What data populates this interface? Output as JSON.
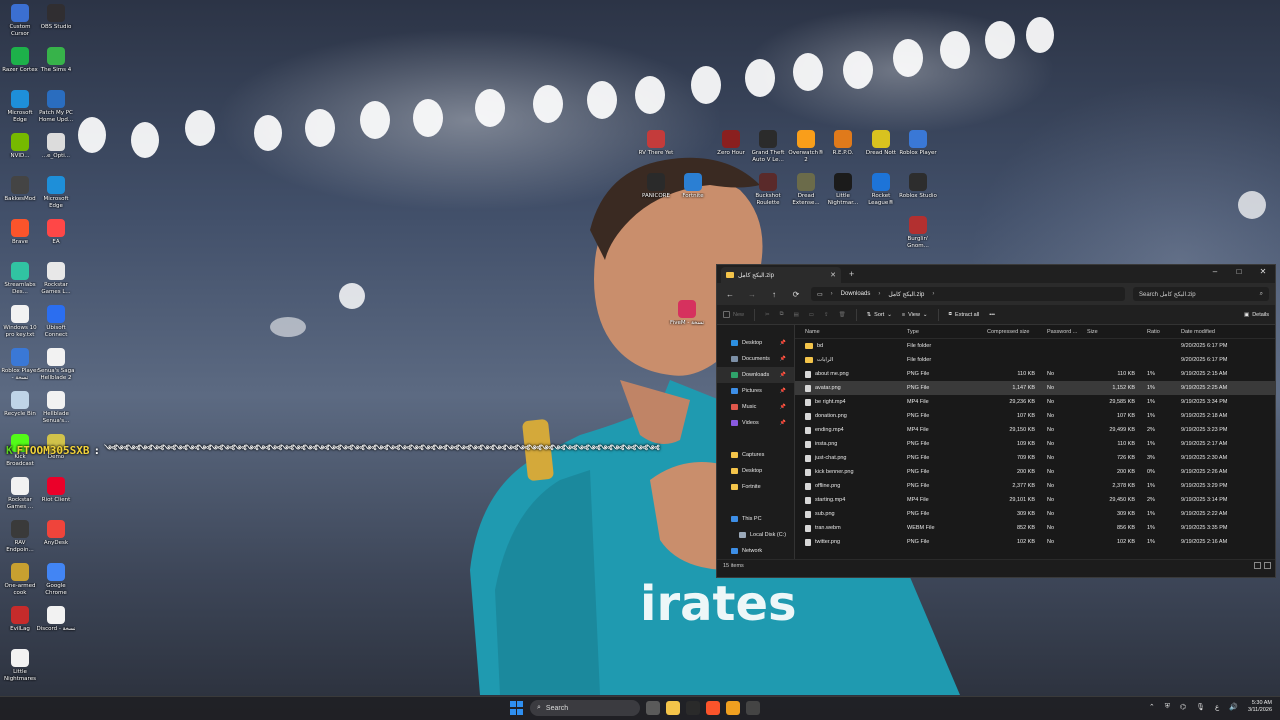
{
  "desktop_icons_left": [
    {
      "label": "Custom Cursor",
      "icon": "cursor-icon",
      "color": "#3b6fd1"
    },
    {
      "label": "OBS Studio",
      "icon": "obs-icon",
      "color": "#302e31"
    },
    {
      "label": "Razer Cortex",
      "icon": "razer-icon",
      "color": "#1db14a"
    },
    {
      "label": "The Sims 4",
      "icon": "sims-icon",
      "color": "#37b34a"
    },
    {
      "label": "Microsoft Edge",
      "icon": "edge-icon",
      "color": "#1e8fd9"
    },
    {
      "label": "Patch My PC Home Upd...",
      "icon": "patch-icon",
      "color": "#2a6dbf"
    },
    {
      "label": "NVID...",
      "icon": "nvidia-icon",
      "color": "#76b900"
    },
    {
      "label": "...e_Opti...",
      "icon": "optimizer-icon",
      "color": "#dcdcdc"
    },
    {
      "label": "BakkesMod",
      "icon": "bakkesmod-icon",
      "color": "#444444"
    },
    {
      "label": "Microsoft Edge",
      "icon": "edge-icon",
      "color": "#1e8fd9"
    },
    {
      "label": "Brave",
      "icon": "brave-icon",
      "color": "#fb542b"
    },
    {
      "label": "EA",
      "icon": "ea-icon",
      "color": "#ff4747"
    },
    {
      "label": "Streamlabs Des...",
      "icon": "streamlabs-icon",
      "color": "#31c3a2"
    },
    {
      "label": "Rockstar Games L...",
      "icon": "rockstar-icon",
      "color": "#e8e8e8"
    },
    {
      "label": "Windows 10 pro key.txt",
      "icon": "text-file-icon",
      "color": "#f2f2f2"
    },
    {
      "label": "Ubisoft Connect",
      "icon": "ubisoft-icon",
      "color": "#2b6ef0"
    },
    {
      "label": "Roblox Player - نسخة",
      "icon": "roblox-icon",
      "color": "#3a78d6"
    },
    {
      "label": "Senua's Saga Hellblade 2",
      "icon": "file-icon",
      "color": "#f2f2f2"
    },
    {
      "label": "Recycle Bin",
      "icon": "recycle-bin-icon",
      "color": "#bfd4e8"
    },
    {
      "label": "Hellblade Senua's...",
      "icon": "file-icon",
      "color": "#f2f2f2"
    },
    {
      "label": "Kick Broadcast",
      "icon": "kick-icon",
      "color": "#53fc18"
    },
    {
      "label": "Demo",
      "icon": "demo-icon",
      "color": "#d1c24a"
    },
    {
      "label": "Rockstar Games ...",
      "icon": "file-icon",
      "color": "#f2f2f2"
    },
    {
      "label": "Riot Client",
      "icon": "riot-icon",
      "color": "#eb0029"
    },
    {
      "label": "RAV Endpoin...",
      "icon": "rav-icon",
      "color": "#3a3a3a"
    },
    {
      "label": "AnyDesk",
      "icon": "anydesk-icon",
      "color": "#ef443b"
    },
    {
      "label": "One-armed cook",
      "icon": "game-icon",
      "color": "#c8a030"
    },
    {
      "label": "Google Chrome",
      "icon": "chrome-icon",
      "color": "#4285f4"
    },
    {
      "label": "EvilLag",
      "icon": "evillag-icon",
      "color": "#c62b2b"
    },
    {
      "label": "Discord - نسخة",
      "icon": "file-icon",
      "color": "#f2f2f2"
    },
    {
      "label": "Little Nightmares",
      "icon": "file-icon",
      "color": "#f2f2f2"
    }
  ],
  "desktop_icons_middle": [
    {
      "label": "RV There Yet",
      "icon": "rv-icon",
      "color": "#c43b3b"
    },
    {
      "label": "Zero Hour",
      "icon": "zero-hour-icon",
      "color": "#8a1f1f"
    },
    {
      "label": "Grand Theft Auto V Le...",
      "icon": "gta-icon",
      "color": "#2b2b2b"
    },
    {
      "label": "Overwatch® 2",
      "icon": "overwatch-icon",
      "color": "#f99e1a"
    },
    {
      "label": "R.E.P.O.",
      "icon": "repo-icon",
      "color": "#e07a1b"
    },
    {
      "label": "Dread Nott",
      "icon": "dread-icon",
      "color": "#d8c21f"
    },
    {
      "label": "Roblox Player",
      "icon": "roblox-icon",
      "color": "#3a78d6"
    },
    {
      "label": "PANICORE",
      "icon": "panicore-icon",
      "color": "#2a2a2a"
    },
    {
      "label": "Fortnite",
      "icon": "fortnite-icon",
      "color": "#2b7fd3"
    },
    {
      "label": "Buckshot Roulette",
      "icon": "buckshot-icon",
      "color": "#5a2a2a"
    },
    {
      "label": "Dread Extense...",
      "icon": "dread-ext-icon",
      "color": "#6b6b4a"
    },
    {
      "label": "Little Nightmar...",
      "icon": "little-nightmares-icon",
      "color": "#1b1b1b"
    },
    {
      "label": "Rocket League®",
      "icon": "rocket-league-icon",
      "color": "#1d74d8"
    },
    {
      "label": "Roblox Studio",
      "icon": "roblox-studio-icon",
      "color": "#2d2d2d"
    },
    {
      "label": "Burglin' Gnom...",
      "icon": "burglin-icon",
      "color": "#b33030"
    },
    {
      "label": "FiveM - نسخة",
      "icon": "fivem-icon",
      "color": "#d6315e"
    }
  ],
  "overlay_chat": {
    "tag": "K",
    "username": "FTOOM305SXB",
    "separator": ":",
    "message": "༺༺༺༺༺༺༺༺༺༺༺༺༺༺༺༺༺༺༺༺༺༺༺༺༺༺༺༺༺༺༺༺༺༺༺༺༺༺༺༺༺༺༺༺༺༺༺"
  },
  "explorer": {
    "tab_title": "البكج كامل.zip",
    "new_tab": "+",
    "controls": {
      "minimize": "–",
      "maximize": "□",
      "close": "✕"
    },
    "nav": {
      "back": "←",
      "forward": "→",
      "up": "↑",
      "refresh": "⟳"
    },
    "breadcrumb": [
      "Downloads",
      "البكج كامل.zip"
    ],
    "search_placeholder": "Search البكج كامل.zip",
    "toolbar": {
      "new": "New",
      "sort": "Sort",
      "view": "View",
      "extract_all": "Extract all",
      "more": "•••",
      "details": "Details"
    },
    "nav_pane": [
      {
        "label": "Desktop",
        "color": "#2d8fe0",
        "pinned": true
      },
      {
        "label": "Documents",
        "color": "#7c8fa6",
        "pinned": true
      },
      {
        "label": "Downloads",
        "color": "#2fa36b",
        "pinned": true,
        "active": true
      },
      {
        "label": "Pictures",
        "color": "#3d8ee6",
        "pinned": true
      },
      {
        "label": "Music",
        "color": "#e0574b",
        "pinned": true
      },
      {
        "label": "Videos",
        "color": "#8a5ae0",
        "pinned": true
      },
      {
        "label": "Captures",
        "color": "#f4c44a",
        "pinned": false
      },
      {
        "label": "Desktop",
        "color": "#f4c44a",
        "pinned": false
      },
      {
        "label": "Fortnite",
        "color": "#f4c44a",
        "pinned": false
      },
      {
        "label": "This PC",
        "color": "#3d8ee6",
        "pinned": false
      },
      {
        "label": "Local Disk (C:)",
        "color": "#9aa8b8",
        "pinned": false
      },
      {
        "label": "Network",
        "color": "#3d8ee6",
        "pinned": false
      }
    ],
    "columns": [
      "Name",
      "Type",
      "Compressed size",
      "Password ...",
      "Size",
      "Ratio",
      "Date modified"
    ],
    "files": [
      {
        "name": "bd",
        "type": "File folder",
        "compressed": "",
        "password": "",
        "size": "",
        "ratio": "",
        "date": "9/20/2025 6:17 PM",
        "kind": "folder"
      },
      {
        "name": "الرابات",
        "type": "File folder",
        "compressed": "",
        "password": "",
        "size": "",
        "ratio": "",
        "date": "9/20/2025 6:17 PM",
        "kind": "folder"
      },
      {
        "name": "about me.png",
        "type": "PNG File",
        "compressed": "110 KB",
        "password": "No",
        "size": "110 KB",
        "ratio": "1%",
        "date": "9/19/2025 2:15 AM",
        "kind": "file"
      },
      {
        "name": "avatar.png",
        "type": "PNG File",
        "compressed": "1,147 KB",
        "password": "No",
        "size": "1,152 KB",
        "ratio": "1%",
        "date": "9/19/2025 2:25 AM",
        "kind": "file",
        "selected": true
      },
      {
        "name": "be right.mp4",
        "type": "MP4 File",
        "compressed": "29,236 KB",
        "password": "No",
        "size": "29,585 KB",
        "ratio": "1%",
        "date": "9/19/2025 3:34 PM",
        "kind": "file"
      },
      {
        "name": "donation.png",
        "type": "PNG File",
        "compressed": "107 KB",
        "password": "No",
        "size": "107 KB",
        "ratio": "1%",
        "date": "9/19/2025 2:18 AM",
        "kind": "file"
      },
      {
        "name": "ending.mp4",
        "type": "MP4 File",
        "compressed": "29,150 KB",
        "password": "No",
        "size": "29,499 KB",
        "ratio": "2%",
        "date": "9/19/2025 3:23 PM",
        "kind": "file"
      },
      {
        "name": "insta.png",
        "type": "PNG File",
        "compressed": "109 KB",
        "password": "No",
        "size": "110 KB",
        "ratio": "1%",
        "date": "9/19/2025 2:17 AM",
        "kind": "file"
      },
      {
        "name": "just-chat.png",
        "type": "PNG File",
        "compressed": "709 KB",
        "password": "No",
        "size": "726 KB",
        "ratio": "3%",
        "date": "9/19/2025 2:30 AM",
        "kind": "file"
      },
      {
        "name": "kick benner.png",
        "type": "PNG File",
        "compressed": "200 KB",
        "password": "No",
        "size": "200 KB",
        "ratio": "0%",
        "date": "9/19/2025 2:26 AM",
        "kind": "file"
      },
      {
        "name": "offline.png",
        "type": "PNG File",
        "compressed": "2,377 KB",
        "password": "No",
        "size": "2,378 KB",
        "ratio": "1%",
        "date": "9/19/2025 3:29 PM",
        "kind": "file"
      },
      {
        "name": "starting.mp4",
        "type": "MP4 File",
        "compressed": "29,101 KB",
        "password": "No",
        "size": "29,450 KB",
        "ratio": "2%",
        "date": "9/19/2025 3:14 PM",
        "kind": "file"
      },
      {
        "name": "sub.png",
        "type": "PNG File",
        "compressed": "309 KB",
        "password": "No",
        "size": "309 KB",
        "ratio": "1%",
        "date": "9/19/2025 2:22 AM",
        "kind": "file"
      },
      {
        "name": "tran.webm",
        "type": "WEBM File",
        "compressed": "852 KB",
        "password": "No",
        "size": "856 KB",
        "ratio": "1%",
        "date": "9/19/2025 3:35 PM",
        "kind": "file"
      },
      {
        "name": "twitter.png",
        "type": "PNG File",
        "compressed": "102 KB",
        "password": "No",
        "size": "102 KB",
        "ratio": "1%",
        "date": "9/19/2025 2:16 AM",
        "kind": "file"
      }
    ],
    "status": "15 items"
  },
  "taskbar": {
    "search_label": "Search",
    "apps": [
      {
        "name": "file-explorer-icon",
        "color": "#f4c44a"
      },
      {
        "name": "epic-games-icon",
        "color": "#2a2a2a"
      },
      {
        "name": "brave-icon",
        "color": "#fb542b"
      },
      {
        "name": "discord-icon",
        "color": "#f0a020"
      },
      {
        "name": "obs-icon",
        "color": "#444444"
      }
    ],
    "time": "5:30 AM",
    "date": "3/11/2026",
    "lang": "ع"
  }
}
